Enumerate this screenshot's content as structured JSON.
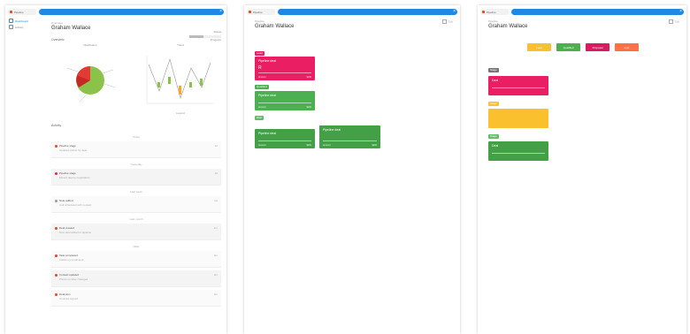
{
  "colors": {
    "blue": "#1e88e5",
    "red": "#e91e63",
    "green": "#4caf50",
    "yellow": "#fbc02d",
    "orange": "#ff7043",
    "magenta": "#d81b60",
    "grey": "#757575"
  },
  "panel1": {
    "tab": "Pipeline",
    "sidebar": [
      {
        "label": "Dashboard",
        "icon": "dashboard-icon"
      },
      {
        "label": "Activity",
        "icon": "activity-icon"
      }
    ],
    "crumb": "Overview",
    "title": "Graham Wallace",
    "progress_label": "Status",
    "progress_value": 0.45,
    "progress_text": "Progress",
    "section_overview": "Overview",
    "pie_title": "Distribution",
    "line_title": "Trend",
    "line_legend": "Legend",
    "section_activity": "Activity",
    "activities": [
      {
        "group": "Today",
        "title": "Pipeline stage",
        "sub": "Updated status for deal",
        "time": "1d",
        "color": "#e64a19"
      },
      {
        "group": "Yesterday",
        "title": "Pipeline stage",
        "sub": "Moved deal to negotiation",
        "time": "2d",
        "color": "#e91e63"
      },
      {
        "group": "Last week",
        "title": "Note added",
        "sub": "Call scheduled with contact",
        "time": "1w",
        "color": "#9e9e9e"
      },
      {
        "group": "Last month",
        "title": "Deal created",
        "sub": "New deal added to pipeline",
        "time": "1m",
        "color": "#e64a19"
      },
      {
        "group": "Older",
        "title": "Task completed",
        "sub": "Follow up email sent",
        "time": "2m",
        "color": "#e53935"
      },
      {
        "group": "",
        "title": "Contact updated",
        "sub": "Phone number changed",
        "time": "3m",
        "color": "#e64a19"
      },
      {
        "group": "",
        "title": "Deal won",
        "sub": "Contract signed",
        "time": "4m",
        "color": "#e64a19"
      }
    ]
  },
  "panel2": {
    "tab": "Pipeline",
    "crumb": "Pipeline",
    "title": "Graham Wallace",
    "edit_label": "Edit",
    "sections": [
      {
        "badge": "Lead",
        "badge_color": "#e91e63"
      },
      {
        "badge": "Qualified",
        "badge_color": "#4caf50"
      },
      {
        "badge": "Won",
        "badge_color": "#66bb6a"
      }
    ],
    "cards": [
      {
        "title": "Pipeline deal",
        "icon": "R",
        "foot_left": "Amount",
        "foot_right": "$200",
        "color": "#e91e63"
      },
      {
        "title": "Pipeline deal",
        "icon": "",
        "foot_left": "Amount",
        "foot_right": "$200",
        "color": "#4caf50"
      },
      {
        "title": "Pipeline deal",
        "icon": "",
        "foot_left": "Amount",
        "foot_right": "$200",
        "color": "#43a047"
      },
      {
        "title": "Pipeline deal",
        "icon": "",
        "foot_left": "Amount",
        "foot_right": "$200",
        "color": "#43a047"
      }
    ]
  },
  "panel3": {
    "tab": "Pipeline",
    "crumb": "Pipeline",
    "title": "Graham Wallace",
    "edit_label": "Edit",
    "filters": [
      {
        "label": "Lead",
        "color": "#fbc02d"
      },
      {
        "label": "Qualified",
        "color": "#4caf50"
      },
      {
        "label": "Proposal",
        "color": "#d81b60"
      },
      {
        "label": "Lost",
        "color": "#ff7043"
      }
    ],
    "sections": [
      {
        "badge": "Stage",
        "badge_color": "#757575"
      },
      {
        "badge": "Stage",
        "badge_color": "#fbc02d"
      },
      {
        "badge": "Stage",
        "badge_color": "#66bb6a"
      }
    ],
    "cards": [
      {
        "title": "Deal",
        "foot_left": "",
        "foot_right": "",
        "color": "#e91e63"
      },
      {
        "title": "",
        "foot_left": "",
        "foot_right": "",
        "color": "#fbc02d"
      },
      {
        "title": "Deal",
        "foot_left": "",
        "foot_right": "",
        "color": "#43a047"
      }
    ]
  }
}
